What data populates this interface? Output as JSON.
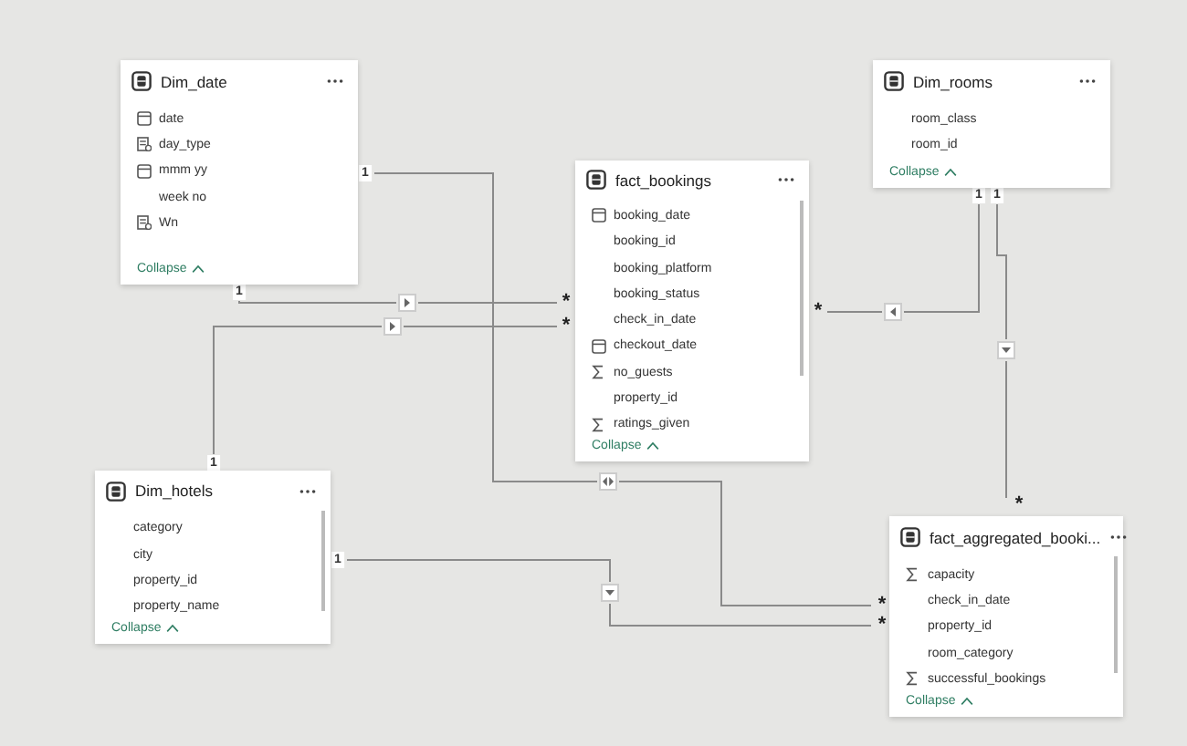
{
  "tables": [
    {
      "name": "Dim_date",
      "scrollable": false,
      "collapse": "Collapse",
      "fields": [
        {
          "name": "date",
          "kind": "calendar"
        },
        {
          "name": "day_type",
          "kind": "calc"
        },
        {
          "name": "mmm yy",
          "kind": "calendar"
        },
        {
          "name": "week no",
          "kind": "plain"
        },
        {
          "name": "Wn",
          "kind": "calc"
        }
      ]
    },
    {
      "name": "Dim_rooms",
      "scrollable": false,
      "collapse": "Collapse",
      "fields": [
        {
          "name": "room_class",
          "kind": "plain"
        },
        {
          "name": "room_id",
          "kind": "plain"
        }
      ]
    },
    {
      "name": "fact_bookings",
      "scrollable": true,
      "collapse": "Collapse",
      "fields": [
        {
          "name": "booking_date",
          "kind": "calendar"
        },
        {
          "name": "booking_id",
          "kind": "plain"
        },
        {
          "name": "booking_platform",
          "kind": "plain"
        },
        {
          "name": "booking_status",
          "kind": "plain"
        },
        {
          "name": "check_in_date",
          "kind": "plain"
        },
        {
          "name": "checkout_date",
          "kind": "calendar"
        },
        {
          "name": "no_guests",
          "kind": "sum"
        },
        {
          "name": "property_id",
          "kind": "plain"
        },
        {
          "name": "ratings_given",
          "kind": "sum"
        }
      ]
    },
    {
      "name": "Dim_hotels",
      "scrollable": true,
      "collapse": "Collapse",
      "fields": [
        {
          "name": "category",
          "kind": "plain"
        },
        {
          "name": "city",
          "kind": "plain"
        },
        {
          "name": "property_id",
          "kind": "plain"
        },
        {
          "name": "property_name",
          "kind": "plain"
        }
      ]
    },
    {
      "name": "fact_aggregated_booki...",
      "scrollable": true,
      "collapse": "Collapse",
      "fields": [
        {
          "name": "capacity",
          "kind": "sum"
        },
        {
          "name": "check_in_date",
          "kind": "plain"
        },
        {
          "name": "property_id",
          "kind": "plain"
        },
        {
          "name": "room_category",
          "kind": "plain"
        },
        {
          "name": "successful_bookings",
          "kind": "sum"
        }
      ]
    }
  ],
  "relationships": [
    {
      "one": "1",
      "many": "*",
      "kind": "both"
    },
    {
      "one": "1",
      "many": "*",
      "kind": "right"
    },
    {
      "one": "1",
      "many": "*",
      "kind": "right"
    },
    {
      "one": "1",
      "many": "*",
      "kind": "down"
    },
    {
      "one": "1",
      "many": "*",
      "kind": "left"
    },
    {
      "one": "1",
      "many": "*",
      "kind": "down"
    }
  ]
}
